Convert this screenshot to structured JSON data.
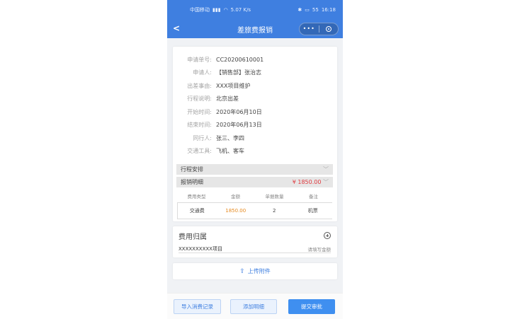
{
  "status_bar": {
    "carrier": "中国移动",
    "net_speed": "5.07 K/s",
    "battery": "55",
    "time": "16:18"
  },
  "nav": {
    "back_icon": "<",
    "title": "差旅费报销"
  },
  "info": [
    {
      "label": "申请单号:",
      "value": "CC20200610001"
    },
    {
      "label": "申请人:",
      "value": "【销售部】张治志"
    },
    {
      "label": "出差事由:",
      "value": "XXX项目维护"
    },
    {
      "label": "行程说明:",
      "value": "北京出差"
    },
    {
      "label": "开始时间:",
      "value": "2020年06月10日"
    },
    {
      "label": "结束时间:",
      "value": "2020年06月13日"
    },
    {
      "label": "同行人:",
      "value": "张三、李四"
    },
    {
      "label": "交通工具:",
      "value": "飞机、客车"
    }
  ],
  "itinerary": {
    "label": "行程安排"
  },
  "reimbursement": {
    "label": "报销明细",
    "total": "¥ 1850.00",
    "columns": [
      "费用类型",
      "金额",
      "单据数量",
      "备注"
    ],
    "rows": [
      {
        "type": "交通费",
        "amount": "1850.00",
        "count": "2",
        "note": "机票"
      }
    ]
  },
  "ownership": {
    "title": "费用归属",
    "project": "XXXXXXXXXX项目",
    "amount_placeholder": "请填写金额"
  },
  "upload": {
    "label": "上传附件"
  },
  "footer": {
    "import_label": "导入消费记录",
    "add_label": "添加明细",
    "submit_label": "提交审批"
  },
  "colors": {
    "brand": "#3f7fe0",
    "total": "#e0393e",
    "amount": "#e68a1f"
  }
}
